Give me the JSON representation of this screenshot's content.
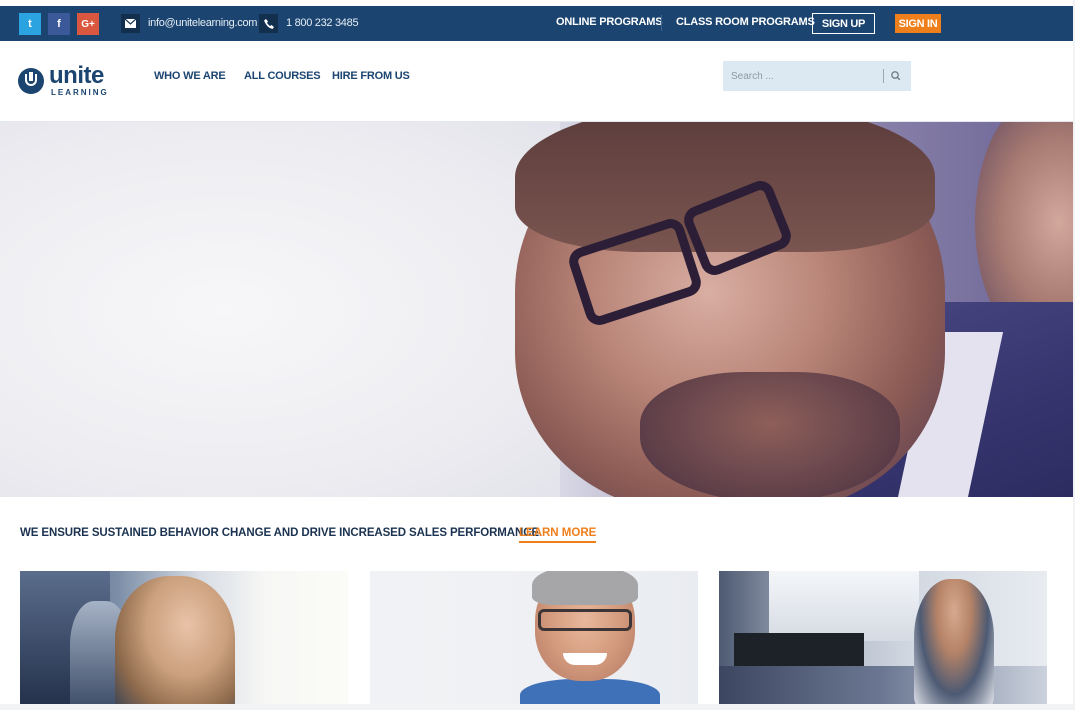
{
  "topbar": {
    "social": [
      {
        "icon": "twitter-icon",
        "glyph": "t",
        "color": "#2aa3e0"
      },
      {
        "icon": "facebook-icon",
        "glyph": "f",
        "color": "#3b5998"
      },
      {
        "icon": "google-plus-icon",
        "glyph": "G+",
        "color": "#d9573e"
      }
    ],
    "email": "info@unitelearning.com",
    "phone": "1 800 232 3485",
    "links": {
      "online": "ONLINE PROGRAMS",
      "classroom": "CLASS ROOM PROGRAMS",
      "signup": "SIGN UP",
      "signin": "SIGN IN"
    },
    "colors": {
      "background": "#1b4570",
      "signin": "#ef7f1a"
    }
  },
  "header": {
    "logo": {
      "word_u": "un",
      "word_rest": "ite",
      "sub": "LEARNING"
    },
    "nav": [
      "WHO WE ARE",
      "ALL COURSES",
      "HIRE FROM US"
    ],
    "search": {
      "placeholder": "Search ..."
    }
  },
  "main": {
    "tagline": "WE ENSURE SUSTAINED BEHAVIOR CHANGE AND DRIVE INCREASED SALES PERFORMANCE.",
    "learn_more": "LEARN MORE",
    "accent": "#ef7f1a"
  }
}
